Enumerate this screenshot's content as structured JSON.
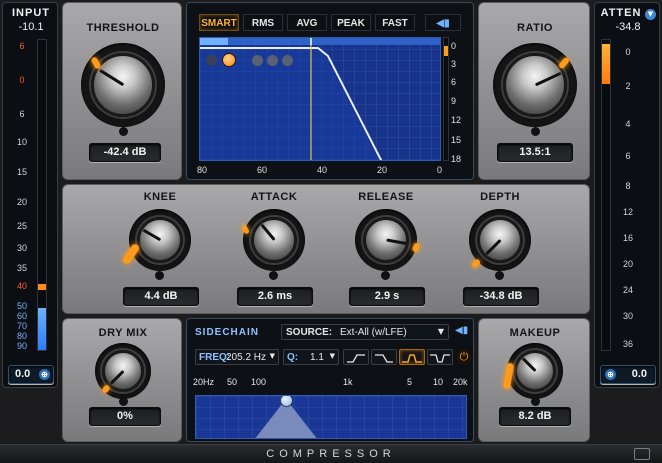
{
  "input": {
    "title": "INPUT",
    "peak": "-10.1",
    "scale": [
      "6",
      "0",
      "6",
      "10",
      "15",
      "20",
      "25",
      "30",
      "35",
      "40",
      "50",
      "60",
      "70",
      "80",
      "90"
    ],
    "value": "0.0"
  },
  "atten": {
    "title": "ATTEN",
    "peak": "-34.8",
    "scale": [
      "0",
      "2",
      "4",
      "6",
      "8",
      "12",
      "16",
      "20",
      "24",
      "30",
      "36"
    ],
    "value": "0.0"
  },
  "threshold": {
    "label": "THRESHOLD",
    "value": "-42.4 dB"
  },
  "ratio": {
    "label": "RATIO",
    "value": "13.5:1"
  },
  "knee": {
    "label": "KNEE",
    "value": "4.4 dB"
  },
  "attack": {
    "label": "ATTACK",
    "value": "2.6 ms"
  },
  "release": {
    "label": "RELEASE",
    "value": "2.9 s"
  },
  "depth": {
    "label": "DEPTH",
    "value": "-34.8 dB"
  },
  "drymix": {
    "label": "DRY MIX",
    "value": "0%"
  },
  "makeup": {
    "label": "MAKEUP",
    "value": "8.2 dB"
  },
  "detector": {
    "modes": [
      "SMART",
      "RMS",
      "AVG",
      "PEAK",
      "FAST"
    ],
    "active": "SMART",
    "x_axis": [
      "80",
      "60",
      "40",
      "20",
      "0"
    ],
    "y_axis": [
      "0",
      "3",
      "6",
      "9",
      "12",
      "15",
      "18"
    ]
  },
  "sidechain": {
    "title": "SIDECHAIN",
    "source_label": "SOURCE:",
    "source_value": "Ext-All (w/LFE)",
    "freq_label": "FREQ:",
    "freq_value": "205.2 Hz",
    "q_label": "Q:",
    "q_value": "1.1",
    "freq_axis": [
      "20Hz",
      "50",
      "100",
      "1k",
      "5",
      "10",
      "20k"
    ]
  },
  "footer": {
    "title": "COMPRESSOR"
  },
  "colors": {
    "accent": "#ffa020",
    "grid": "#2f5bb8",
    "graph_bg": "#17338a"
  }
}
